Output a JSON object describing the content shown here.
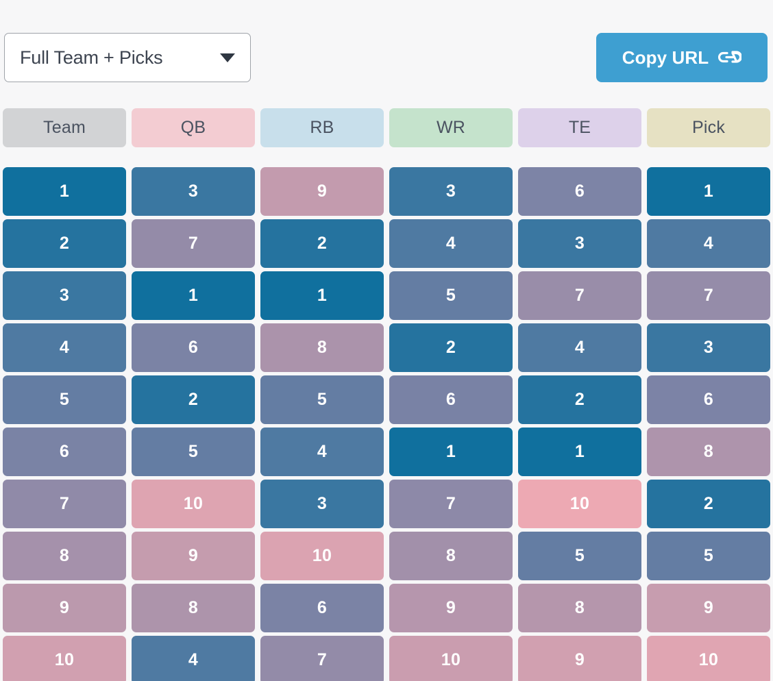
{
  "toolbar": {
    "view_select": {
      "value": "Full Team + Picks",
      "icon": "chevron-down-icon"
    },
    "copy_url": {
      "label": "Copy URL",
      "icon": "link-icon",
      "color": "#3e9fd1"
    }
  },
  "table": {
    "columns": [
      {
        "key": "team",
        "label": "Team",
        "header_color": "#d2d3d5"
      },
      {
        "key": "qb",
        "label": "QB",
        "header_color": "#f3ccd2"
      },
      {
        "key": "rb",
        "label": "RB",
        "header_color": "#c8dfeb"
      },
      {
        "key": "wr",
        "label": "WR",
        "header_color": "#c5e3cc"
      },
      {
        "key": "te",
        "label": "TE",
        "header_color": "#ddd1ea"
      },
      {
        "key": "pick",
        "label": "Pick",
        "header_color": "#e6e1c3"
      }
    ],
    "rows": [
      {
        "team": 1,
        "qb": 3,
        "rb": 9,
        "wr": 3,
        "te": 6,
        "pick": 1
      },
      {
        "team": 2,
        "qb": 7,
        "rb": 2,
        "wr": 4,
        "te": 3,
        "pick": 4
      },
      {
        "team": 3,
        "qb": 1,
        "rb": 1,
        "wr": 5,
        "te": 7,
        "pick": 7
      },
      {
        "team": 4,
        "qb": 6,
        "rb": 8,
        "wr": 2,
        "te": 4,
        "pick": 3
      },
      {
        "team": 5,
        "qb": 2,
        "rb": 5,
        "wr": 6,
        "te": 2,
        "pick": 6
      },
      {
        "team": 6,
        "qb": 5,
        "rb": 4,
        "wr": 1,
        "te": 1,
        "pick": 8
      },
      {
        "team": 7,
        "qb": 10,
        "rb": 3,
        "wr": 7,
        "te": 10,
        "pick": 2
      },
      {
        "team": 8,
        "qb": 9,
        "rb": 10,
        "wr": 8,
        "te": 5,
        "pick": 5
      },
      {
        "team": 9,
        "qb": 8,
        "rb": 6,
        "wr": 9,
        "te": 8,
        "pick": 9
      },
      {
        "team": 10,
        "qb": 4,
        "rb": 7,
        "wr": 10,
        "te": 9,
        "pick": 10
      }
    ],
    "rank_scale": {
      "min_rank": 1,
      "max_rank": 10,
      "best_color": "#10709e",
      "worst_color": "#eda9b3",
      "column_intensity": {
        "team": 0.78,
        "qb": 0.88,
        "rb": 0.86,
        "wr": 0.72,
        "te": 1.0,
        "pick": 0.9
      }
    }
  },
  "page": {
    "background": "#f7f7f8"
  }
}
